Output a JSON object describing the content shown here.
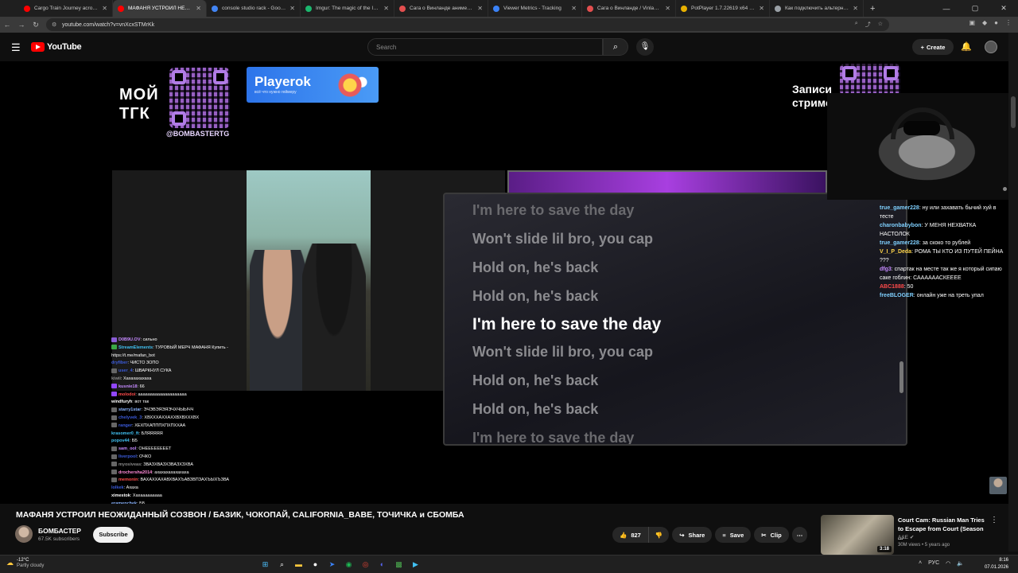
{
  "browser": {
    "tabs": [
      {
        "label": "Cargo Train Journey across Argy",
        "color": "#ff0000",
        "active": false
      },
      {
        "label": "МАФАНЯ УСТРОИЛ НЕОЖИДАН",
        "color": "#ff0000",
        "active": true
      },
      {
        "label": "console studio rack - Google Se",
        "color": "#4285f4",
        "active": false
      },
      {
        "label": "Imgur: The magic of the Interne",
        "color": "#1bb76e",
        "active": false
      },
      {
        "label": "Сага о Винланде аниме 2019",
        "color": "#e34f4f",
        "active": false
      },
      {
        "label": "Viewer Metrics - Tracking",
        "color": "#3b82f6",
        "active": false
      },
      {
        "label": "Сага о Винланде / Vinland Sag",
        "color": "#e34f4f",
        "active": false
      },
      {
        "label": "PotPlayer 1.7.22619 x64 RePack",
        "color": "#e8b100",
        "active": false
      },
      {
        "label": "Как подключить альтернатив",
        "color": "#9aa0a6",
        "active": false
      }
    ],
    "new_tab": "+",
    "url": "youtube.com/watch?v=vnXcxSTMrKk"
  },
  "youtube": {
    "logo_text": "YouTube",
    "search_placeholder": "Search",
    "create_label": "Create"
  },
  "stream": {
    "overlay_left_text": "МОЙ ТГК",
    "handle": "@BOMBASTERTG",
    "playerok_title": "Playerok",
    "playerok_sub": "всё что нужно геймеру",
    "overlay_right_text": "Записи стримо",
    "lyrics": [
      {
        "text": "I'm here to save the day",
        "state": "faded"
      },
      {
        "text": "Won't slide lil bro, you cap",
        "state": "normal"
      },
      {
        "text": "Hold on, he's back",
        "state": "normal"
      },
      {
        "text": "Hold on, he's back",
        "state": "normal"
      },
      {
        "text": "I'm here to save the day",
        "state": "current"
      },
      {
        "text": "Won't slide lil bro, you cap",
        "state": "normal"
      },
      {
        "text": "Hold on, he's back",
        "state": "normal"
      },
      {
        "text": "Hold on, he's back",
        "state": "normal"
      },
      {
        "text": "I'm here to save the day",
        "state": "faded"
      }
    ],
    "right_chat": [
      {
        "user": "true_gamer228",
        "color": "#7fd0ff",
        "text": "ну или захавать бычий хуй в тесте"
      },
      {
        "user": "charonbabybon",
        "color": "#7fd0ff",
        "text": "У МЕНЯ НЕХВАТКА НАСТОЛОК"
      },
      {
        "user": "true_gamer228",
        "color": "#7fd0ff",
        "text": "за скоко то рублей"
      },
      {
        "user": "V_I_P_Deda",
        "color": "#ffd54a",
        "text": "РОМА ТЫ КТО ИЗ ПУТЕЙ ПЕЙНА ???"
      },
      {
        "user": "dfg3",
        "color": "#c58aff",
        "text": "спартак на месте так же я который сипаю саке гоблин: СААААААСКЕЕЕЕ"
      },
      {
        "user": "ABC1888",
        "color": "#ff4b4b",
        "text": "50"
      },
      {
        "user": "freeBLOGER",
        "color": "#7fd0ff",
        "text": "онлайн уже на треть упал"
      }
    ],
    "left_chat": [
      {
        "user": "D0B9U.OV",
        "color": "#c58aff",
        "badge": "#8a5cd6",
        "text": "сильно"
      },
      {
        "user": "StreamElements",
        "color": "#41c1f2",
        "badge": "#3aa845",
        "text": "ТУРОВЫЙ МЕРЧ МАФАНЯ Купить - https://t.me/mafan_bot"
      },
      {
        "user": "dryfiber",
        "color": "#3b5bdb",
        "badge": "",
        "text": "ЧИСТО ЗОПО"
      },
      {
        "user": "user_4",
        "color": "#3b5bdb",
        "badge": "#666",
        "text": "ШВАРКНУЛ СУКА"
      },
      {
        "user": "kiwii",
        "color": "#8a8a8a",
        "badge": "",
        "text": "Хахахахахаха"
      },
      {
        "user": "kusnie18",
        "color": "#c58aff",
        "badge": "#9146ff",
        "text": "66"
      },
      {
        "user": "molodoi",
        "color": "#ff4b4b",
        "badge": "#9146ff",
        "text": "аааааааааааааааааааа"
      },
      {
        "user": "windfuryh",
        "color": "#ffffff",
        "badge": "",
        "text": "вот так"
      },
      {
        "user": "starry1star",
        "color": "#8ab4ff",
        "badge": "#666",
        "text": "ЭЧЭВЭЯЭЯЭЧХЧЫЫЧЧ"
      },
      {
        "user": "chelyvek_3",
        "color": "#3b5bdb",
        "badge": "#666",
        "text": "ХВХХХАХХАХХВХВХХХВХ"
      },
      {
        "user": "ranger",
        "color": "#3b5bdb",
        "badge": "#666",
        "text": "ХЕХПХАПППХПХПХХАА"
      },
      {
        "user": "krasomer0_ft",
        "color": "#41c1f2",
        "badge": "",
        "text": "БЛЯЯЯЯЯ"
      },
      {
        "user": "popov44",
        "color": "#41c1f2",
        "badge": "",
        "text": "ББ"
      },
      {
        "user": "sam_ool",
        "color": "#c58aff",
        "badge": "#666",
        "text": "ОНЕЕЕЕЕЕЕЕТ"
      },
      {
        "user": "liverpool",
        "color": "#3b5bdb",
        "badge": "#666",
        "text": "ОЧКО"
      },
      {
        "user": "myosiveas",
        "color": "#8a8a8a",
        "badge": "#666",
        "text": "ЗВАЗХВАЗХЗВАЗХЗХВА"
      },
      {
        "user": "drochersha2014",
        "color": "#ff8ad8",
        "badge": "#666",
        "text": "ахахахахахахаха"
      },
      {
        "user": "memonin",
        "color": "#ff4b4b",
        "badge": "#666",
        "text": "ВАХАХХАХАВХВАХЪАВЗВПЗАХЪЫХЪЗВА"
      },
      {
        "user": "lolkek",
        "color": "#3b5bdb",
        "badge": "",
        "text": "Ахаха"
      },
      {
        "user": "ximestok",
        "color": "#ffffff",
        "badge": "",
        "text": "Хахааааааааа"
      },
      {
        "user": "eramenchek",
        "color": "#8ab4ff",
        "badge": "",
        "text": "ББ"
      }
    ]
  },
  "video": {
    "title": "МАФАНЯ УСТРОИЛ НЕОЖИДАННЫЙ СОЗВОН / БАЗИК, ЧОКОПАЙ, CALIFORNIA_BABE, ТОЧИЧКА и СБОМБА",
    "channel": "БОМБАСТЕР",
    "subscribers": "67.5K subscribers",
    "subscribe_label": "Subscribe",
    "likes": "827",
    "share_label": "Share",
    "save_label": "Save",
    "clip_label": "Clip",
    "more_label": "⋯"
  },
  "recommended": {
    "title": "Court Cam: Russian Man Tries to Escape from Court (Season ...",
    "channel": "A&E",
    "meta": "30M views • 5 years ago",
    "duration": "3:18"
  },
  "taskbar": {
    "temp": "-12°C",
    "weather": "Partly cloudy",
    "lang": "РУС",
    "time": "8:16",
    "date": "07.01.2026"
  },
  "icons": {
    "accent_red": "#ff0000",
    "chat_user_blue": "#7fd0ff"
  }
}
